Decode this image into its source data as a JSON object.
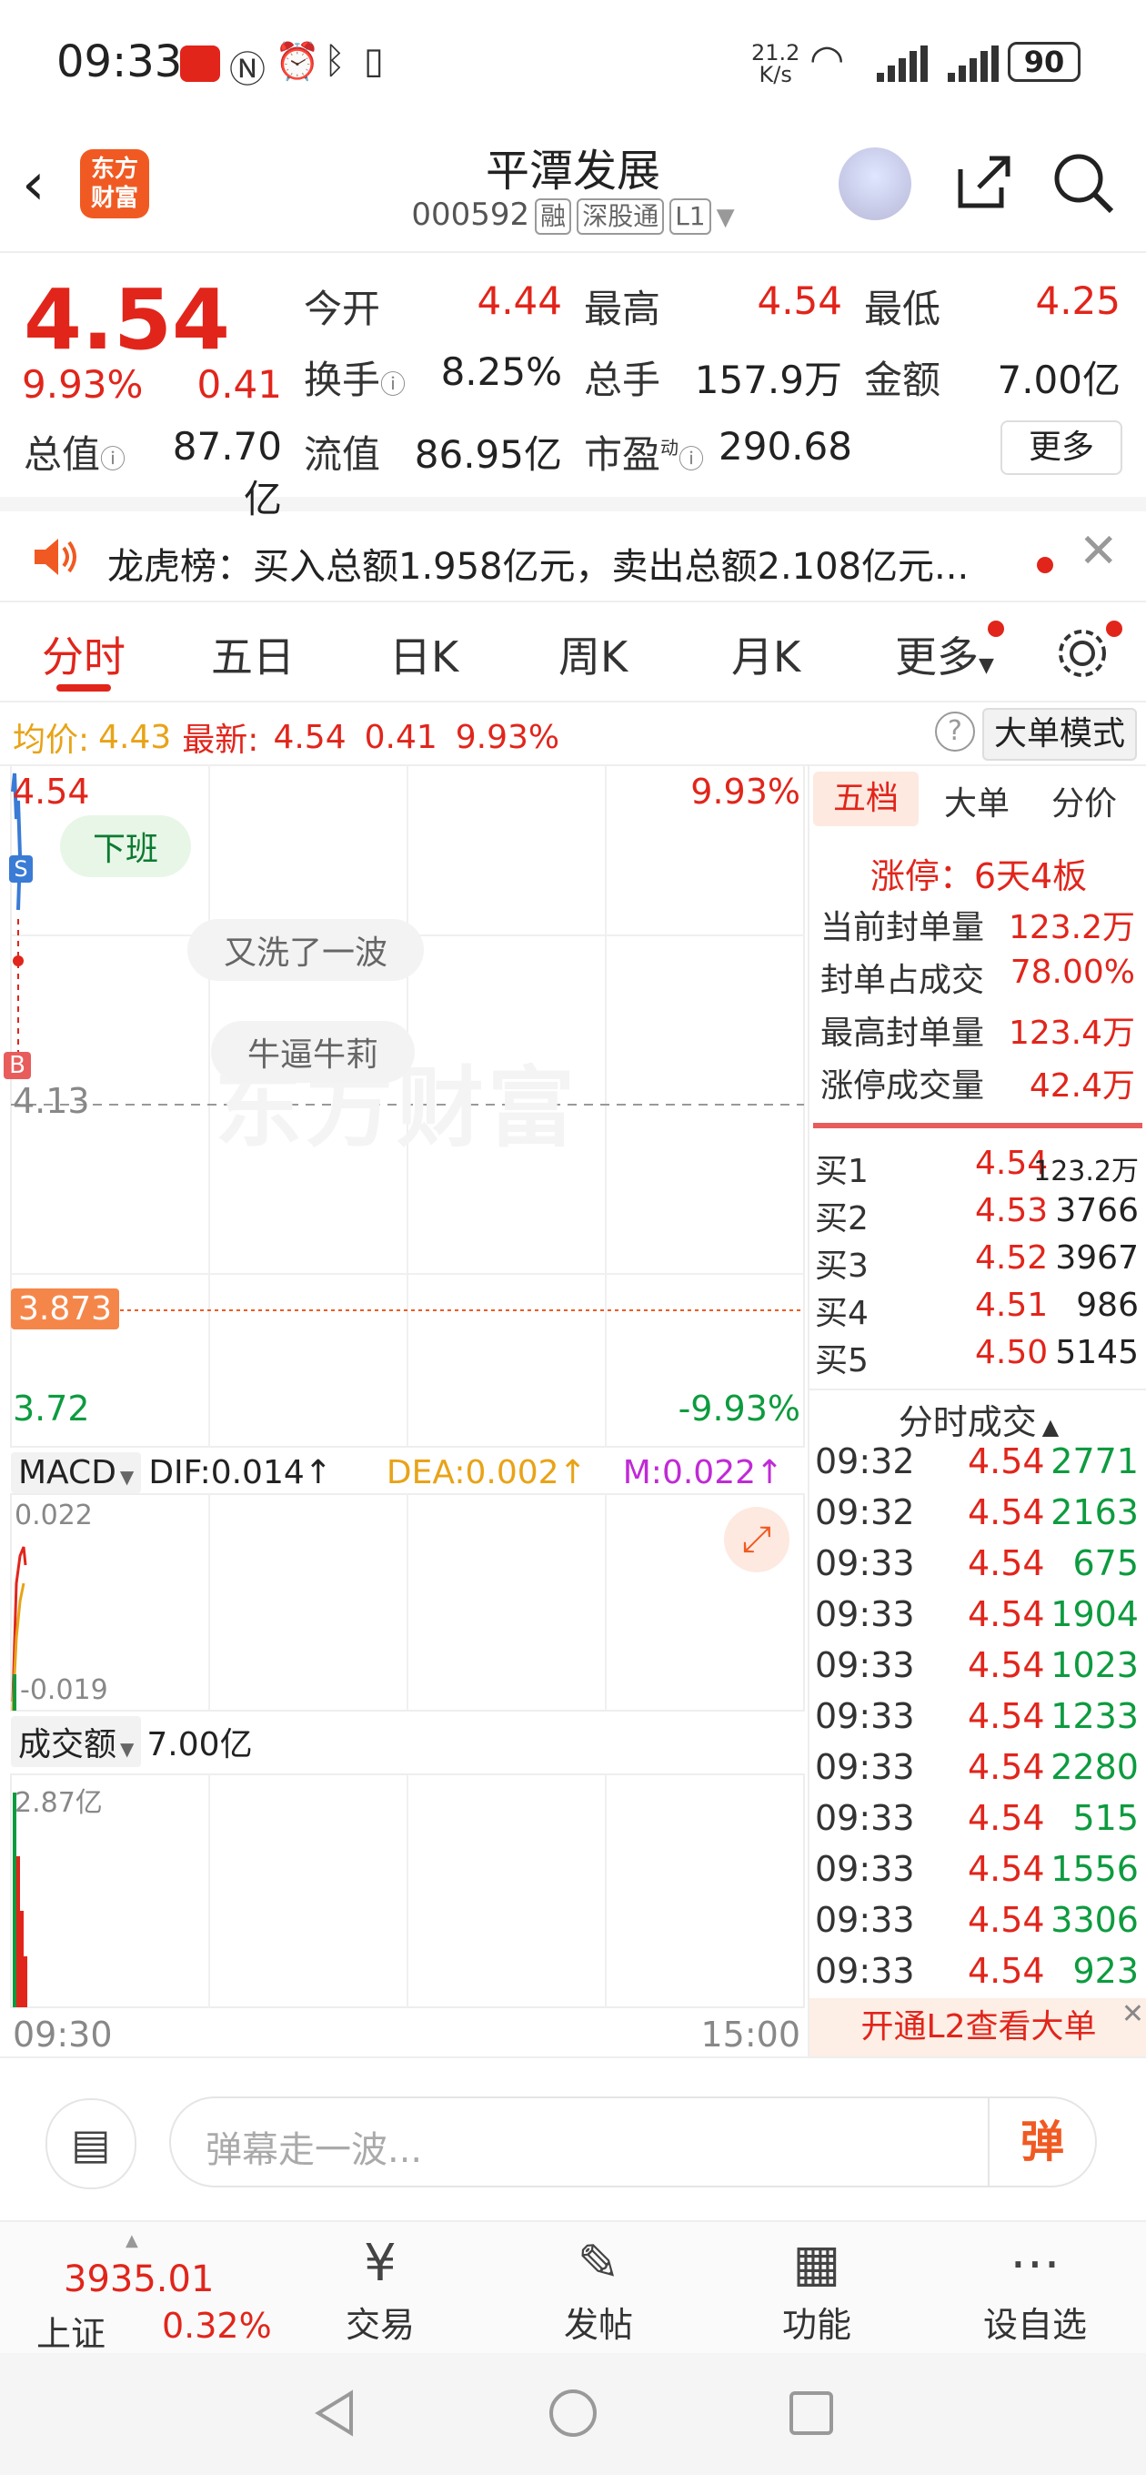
{
  "status": {
    "time": "09:33",
    "speed": "21.2",
    "speed_unit": "K/s",
    "battery": "90"
  },
  "header": {
    "logo_line1": "东方",
    "logo_line2": "财富",
    "name": "平潭发展",
    "code": "000592",
    "tags": [
      "融",
      "深股通",
      "L1"
    ]
  },
  "quote": {
    "price": "4.54",
    "change_pct": "9.93%",
    "change": "0.41",
    "fields": {
      "open_label": "今开",
      "open": "4.44",
      "high_label": "最高",
      "high": "4.54",
      "low_label": "最低",
      "low": "4.25",
      "turnover_label": "换手",
      "turnover": "8.25%",
      "volume_label": "总手",
      "volume": "157.9万",
      "amount_label": "金额",
      "amount": "7.00亿",
      "mktcap_label": "总值",
      "mktcap": "87.70亿",
      "float_label": "流值",
      "float": "86.95亿",
      "pe_label": "市盈",
      "pe_sup": "动",
      "pe": "290.68"
    },
    "more_button": "更多"
  },
  "notice": {
    "text": "龙虎榜：买入总额1.958亿元，卖出总额2.108亿元..."
  },
  "tabs": [
    "分时",
    "五日",
    "日K",
    "周K",
    "月K",
    "更多"
  ],
  "infoline": {
    "avg_label": "均价:",
    "avg_value": "4.43",
    "latest_label": "最新:",
    "latest_value": "4.54",
    "latest_change": "0.41",
    "latest_pct": "9.93%",
    "big_order_button": "大单模式"
  },
  "chart": {
    "price_top": "4.54",
    "pct_top": "9.93%",
    "price_mid": "4.13",
    "price_bottom": "3.72",
    "pct_bottom": "-9.93%",
    "marker_price": "3.873",
    "danmaku": [
      "下班",
      "又洗了一波",
      "牛逼牛莉"
    ],
    "watermark": "东方财富",
    "s_marker": "S",
    "b_marker": "B",
    "macd": {
      "selector": "MACD",
      "dif": "DIF:0.014↑",
      "dea": "DEA:0.002↑",
      "m": "M:0.022↑",
      "top": "0.022",
      "bottom": "-0.019"
    },
    "volume": {
      "selector": "成交额",
      "value": "7.00亿",
      "top": "2.87亿"
    },
    "time_start": "09:30",
    "time_end": "15:00",
    "colors": {
      "up": "#e1251b",
      "down": "#0d9b3f",
      "price_line": "#3a7bd5",
      "avg_line": "#e8a317"
    }
  },
  "panel": {
    "tabs": [
      "五档",
      "大单",
      "分价"
    ],
    "limit_up": "涨停：6天4板",
    "stats": [
      {
        "label": "当前封单量",
        "value": "123.2万"
      },
      {
        "label": "封单占成交",
        "value": "78.00%"
      },
      {
        "label": "最高封单量",
        "value": "123.4万"
      },
      {
        "label": "涨停成交量",
        "value": "42.4万"
      }
    ],
    "bids": [
      {
        "label": "买1",
        "price": "4.54",
        "vol": "123.2万"
      },
      {
        "label": "买2",
        "price": "4.53",
        "vol": "3766"
      },
      {
        "label": "买3",
        "price": "4.52",
        "vol": "3967"
      },
      {
        "label": "买4",
        "price": "4.51",
        "vol": "986"
      },
      {
        "label": "买5",
        "price": "4.50",
        "vol": "5145"
      }
    ],
    "ticks_title": "分时成交",
    "ticks": [
      {
        "time": "09:32",
        "price": "4.54",
        "vol": "2771"
      },
      {
        "time": "09:32",
        "price": "4.54",
        "vol": "2163"
      },
      {
        "time": "09:33",
        "price": "4.54",
        "vol": "675"
      },
      {
        "time": "09:33",
        "price": "4.54",
        "vol": "1904"
      },
      {
        "time": "09:33",
        "price": "4.54",
        "vol": "1023"
      },
      {
        "time": "09:33",
        "price": "4.54",
        "vol": "1233"
      },
      {
        "time": "09:33",
        "price": "4.54",
        "vol": "2280"
      },
      {
        "time": "09:33",
        "price": "4.54",
        "vol": "515"
      },
      {
        "time": "09:33",
        "price": "4.54",
        "vol": "1556"
      },
      {
        "time": "09:33",
        "price": "4.54",
        "vol": "3306"
      },
      {
        "time": "09:33",
        "price": "4.54",
        "vol": "923"
      }
    ],
    "l2_banner": "开通L2查看大单"
  },
  "danmu": {
    "placeholder": "弹幕走一波...",
    "send_icon": "弹"
  },
  "bottomnav": {
    "index_value": "3935.01",
    "index_name": "上证",
    "index_pct": "0.32%",
    "items": [
      "交易",
      "发帖",
      "功能",
      "设自选"
    ]
  }
}
